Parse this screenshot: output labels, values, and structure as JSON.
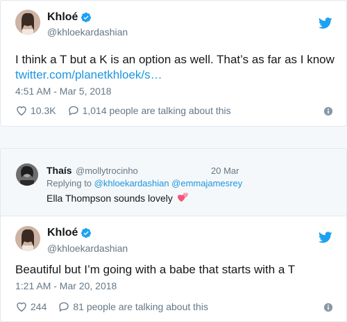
{
  "tweet1": {
    "name": "Khloé",
    "handle": "@khloekardashian",
    "text": "I think a T but a K is an option as well. That’s as far as I know",
    "link": "twitter.com/planetkhloek/s…",
    "timestamp": "4:51 AM - Mar 5, 2018",
    "likes": "10.3K",
    "talking": "1,014 people are talking about this"
  },
  "reply": {
    "name": "Thaís",
    "handle": "@mollytrocinho",
    "date": "20 Mar",
    "replying_prefix": "Replying to",
    "mention1": "@khloekardashian",
    "mention2": "@emmajamesrey",
    "text": "Ella Thompson sounds lovely"
  },
  "tweet2": {
    "name": "Khloé",
    "handle": "@khloekardashian",
    "text": "Beautiful but I’m going with a babe that starts with a T",
    "timestamp": "1:21 AM - Mar 20, 2018",
    "likes": "244",
    "talking": "81 people are talking about this"
  },
  "colors": {
    "twitter_blue": "#1da1f2",
    "link": "#1b95e0",
    "secondary_text": "#657786",
    "border": "#e1e8ed"
  },
  "icons": [
    "verified-icon",
    "twitter-bird-icon",
    "heart-icon",
    "comment-icon",
    "info-icon",
    "hearts-emoji-icon"
  ]
}
